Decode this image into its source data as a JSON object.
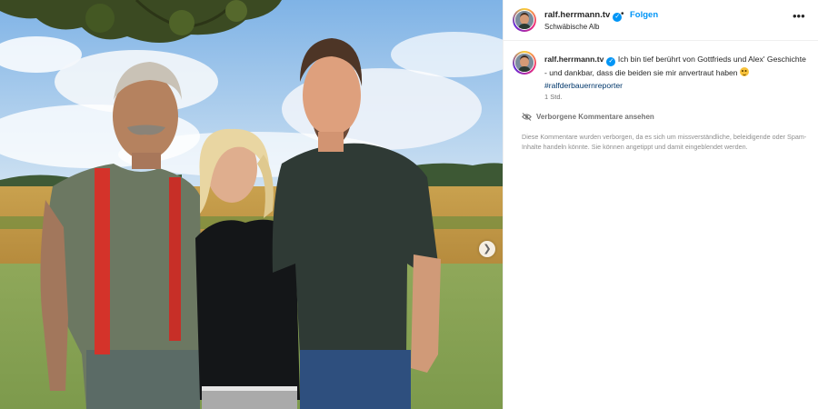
{
  "post": {
    "username": "ralf.herrmann.tv",
    "follow_label": "Folgen",
    "location": "Schwäbische Alb",
    "caption_text": "Ich bin tief berührt von Gottfrieds und Alex' Geschichte - und dankbar, dass die beiden sie mir anvertraut haben",
    "hashtag": "#ralfderbauernreporter",
    "time": "1 Std.",
    "hidden_comments_label": "Verborgene Kommentare ansehen",
    "hidden_comments_note": "Diese Kommentare wurden verborgen, da es sich um missverständliche, beleidigende oder Spam-Inhalte handeln könnte. Sie können angetippt und damit eingeblendet werden."
  },
  "colors": {
    "accent": "#0095f6",
    "text": "#262626",
    "muted": "#737373",
    "hashtag": "#00376b"
  },
  "icons": [
    "verified-badge-icon",
    "more-options-icon",
    "eye-slash-icon",
    "chevron-right-icon",
    "smile-emoji-icon"
  ]
}
